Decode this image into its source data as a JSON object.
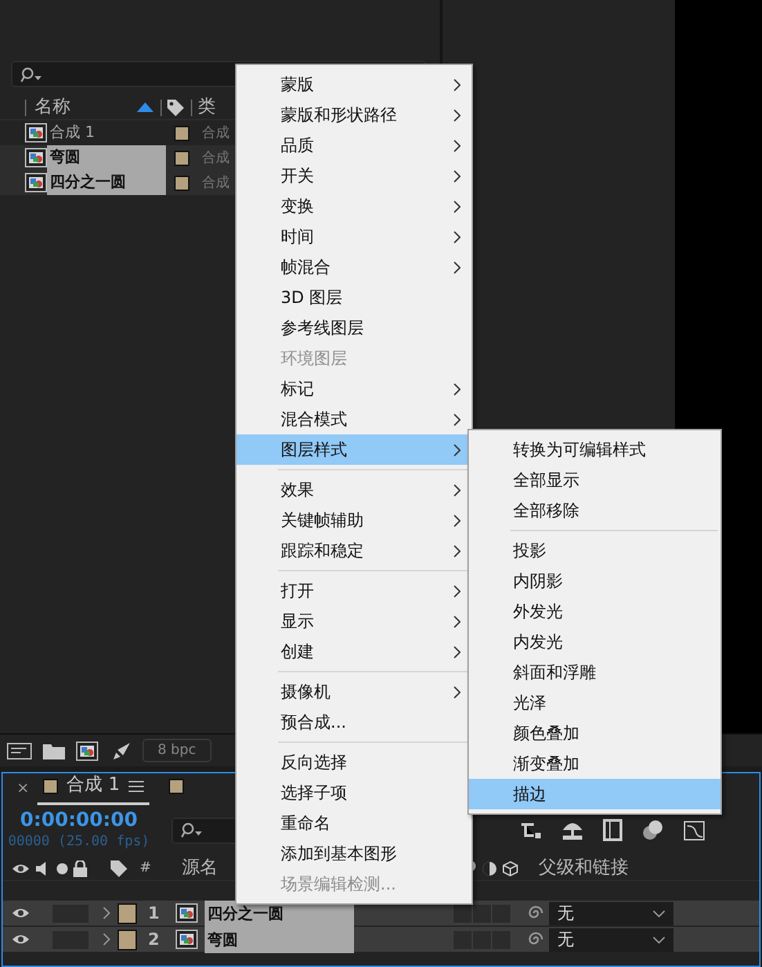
{
  "project": {
    "columns": [
      {
        "label": "名称",
        "sorted": true
      },
      {
        "label": "类"
      }
    ],
    "items": [
      {
        "name": "合成 1",
        "type": "合成",
        "selected": false,
        "color": "#b6a17e"
      },
      {
        "name": "弯圆",
        "type": "合成",
        "selected": true,
        "color": "#b6a17e"
      },
      {
        "name": "四分之一圆",
        "type": "合成",
        "selected": true,
        "color": "#b6a17e"
      }
    ]
  },
  "toolbar": {
    "bpc": "8 bpc"
  },
  "timeline": {
    "tabs": [
      {
        "title": "合成 1",
        "color": "#b6a17e",
        "selected": true
      },
      {
        "color": "#b6a17e",
        "selected": false
      }
    ],
    "close": "×",
    "timecode": "0:00:00:00",
    "fps": "00000 (25.00 fps)",
    "columns": [
      {
        "label": "#"
      },
      {
        "label": "源名"
      },
      {
        "label": "父级和链接"
      }
    ],
    "layers": [
      {
        "number": "1",
        "name": "四分之一圆",
        "parent": "无",
        "color": "#b6a17e",
        "visible": true,
        "selected": true
      },
      {
        "number": "2",
        "name": "弯圆",
        "parent": "无",
        "color": "#b6a17e",
        "visible": true,
        "selected": true
      }
    ]
  },
  "context_menu": {
    "items": [
      {
        "kind": "item",
        "label": "蒙版",
        "submenu": true,
        "disabled": false,
        "selected": false
      },
      {
        "kind": "item",
        "label": "蒙版和形状路径",
        "submenu": true,
        "disabled": false,
        "selected": false
      },
      {
        "kind": "item",
        "label": "品质",
        "submenu": true,
        "disabled": false,
        "selected": false
      },
      {
        "kind": "item",
        "label": "开关",
        "submenu": true,
        "disabled": false,
        "selected": false
      },
      {
        "kind": "item",
        "label": "变换",
        "submenu": true,
        "disabled": false,
        "selected": false
      },
      {
        "kind": "item",
        "label": "时间",
        "submenu": true,
        "disabled": false,
        "selected": false
      },
      {
        "kind": "item",
        "label": "帧混合",
        "submenu": true,
        "disabled": false,
        "selected": false
      },
      {
        "kind": "item",
        "label": "3D 图层",
        "submenu": false,
        "disabled": false,
        "selected": false
      },
      {
        "kind": "item",
        "label": "参考线图层",
        "submenu": false,
        "disabled": false,
        "selected": false
      },
      {
        "kind": "item",
        "label": "环境图层",
        "submenu": false,
        "disabled": true,
        "selected": false
      },
      {
        "kind": "item",
        "label": "标记",
        "submenu": true,
        "disabled": false,
        "selected": false
      },
      {
        "kind": "item",
        "label": "混合模式",
        "submenu": true,
        "disabled": false,
        "selected": false
      },
      {
        "kind": "item",
        "label": "图层样式",
        "submenu": true,
        "disabled": false,
        "selected": true
      },
      {
        "kind": "separator"
      },
      {
        "kind": "item",
        "label": "效果",
        "submenu": true,
        "disabled": false,
        "selected": false
      },
      {
        "kind": "item",
        "label": "关键帧辅助",
        "submenu": true,
        "disabled": false,
        "selected": false
      },
      {
        "kind": "item",
        "label": "跟踪和稳定",
        "submenu": true,
        "disabled": false,
        "selected": false
      },
      {
        "kind": "separator"
      },
      {
        "kind": "item",
        "label": "打开",
        "submenu": true,
        "disabled": false,
        "selected": false
      },
      {
        "kind": "item",
        "label": "显示",
        "submenu": true,
        "disabled": false,
        "selected": false
      },
      {
        "kind": "item",
        "label": "创建",
        "submenu": true,
        "disabled": false,
        "selected": false
      },
      {
        "kind": "separator"
      },
      {
        "kind": "item",
        "label": "摄像机",
        "submenu": true,
        "disabled": false,
        "selected": false
      },
      {
        "kind": "item",
        "label": "预合成...",
        "submenu": false,
        "disabled": false,
        "selected": false
      },
      {
        "kind": "separator"
      },
      {
        "kind": "item",
        "label": "反向选择",
        "submenu": false,
        "disabled": false,
        "selected": false
      },
      {
        "kind": "item",
        "label": "选择子项",
        "submenu": false,
        "disabled": false,
        "selected": false
      },
      {
        "kind": "item",
        "label": "重命名",
        "submenu": false,
        "disabled": false,
        "selected": false
      },
      {
        "kind": "item",
        "label": "添加到基本图形",
        "submenu": false,
        "disabled": false,
        "selected": false
      },
      {
        "kind": "item",
        "label": "场景编辑检测...",
        "submenu": false,
        "disabled": true,
        "selected": false
      }
    ]
  },
  "submenu": {
    "items": [
      {
        "kind": "item",
        "label": "转换为可编辑样式",
        "selected": false
      },
      {
        "kind": "item",
        "label": "全部显示",
        "selected": false
      },
      {
        "kind": "item",
        "label": "全部移除",
        "selected": false
      },
      {
        "kind": "separator"
      },
      {
        "kind": "item",
        "label": "投影",
        "selected": false
      },
      {
        "kind": "item",
        "label": "内阴影",
        "selected": false
      },
      {
        "kind": "item",
        "label": "外发光",
        "selected": false
      },
      {
        "kind": "item",
        "label": "内发光",
        "selected": false
      },
      {
        "kind": "item",
        "label": "斜面和浮雕",
        "selected": false
      },
      {
        "kind": "item",
        "label": "光泽",
        "selected": false
      },
      {
        "kind": "item",
        "label": "颜色叠加",
        "selected": false
      },
      {
        "kind": "item",
        "label": "渐变叠加",
        "selected": false
      },
      {
        "kind": "item",
        "label": "描边",
        "selected": true
      }
    ]
  }
}
